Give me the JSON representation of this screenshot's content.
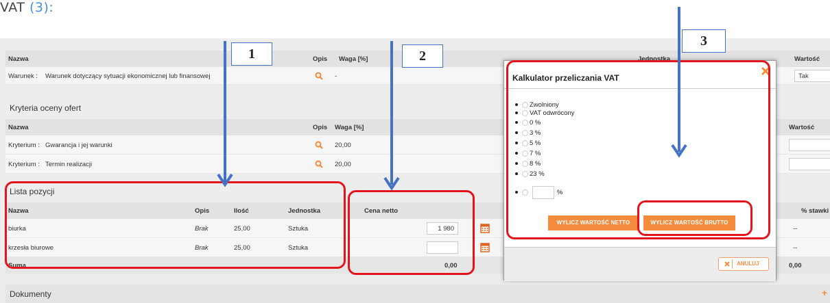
{
  "intro": {
    "text": "VAT",
    "number": "(3):"
  },
  "conditions": {
    "headers": {
      "name": "Nazwa",
      "desc": "Opis",
      "weight": "Waga [%]",
      "unit": "Jednostka",
      "value": "Wartość"
    },
    "row": {
      "label": "Warunek :",
      "text": "Warunek dotyczący sytuacji ekonomicznej lub finansowej",
      "weight": "-",
      "value": "Tak"
    }
  },
  "criteria": {
    "title": "Kryteria oceny ofert",
    "headers": {
      "name": "Nazwa",
      "desc": "Opis",
      "weight": "Waga [%]",
      "value": "Wartość"
    },
    "rows": [
      {
        "label": "Kryterium :",
        "text": "Gwarancja i jej warunki",
        "weight": "20,00"
      },
      {
        "label": "Kryterium :",
        "text": "Termin realizacji",
        "weight": "20,00"
      }
    ]
  },
  "positions": {
    "title": "Lista pozycji",
    "headers": {
      "name": "Nazwa",
      "desc": "Opis",
      "qty": "Ilość",
      "unit": "Jednostka",
      "price": "Cena netto",
      "vat_rate": "% stawki"
    },
    "rows": [
      {
        "name": "biurka",
        "desc": "Brak",
        "qty": "25,00",
        "unit": "Sztuka",
        "price": "1 980",
        "vat": "--"
      },
      {
        "name": "krzesła biurowe",
        "desc": "Brak",
        "qty": "25,00",
        "unit": "Sztuka",
        "price": "",
        "vat": "--"
      }
    ],
    "sum_label": "Suma",
    "sum_price": "0,00",
    "sum_right": "0,00"
  },
  "documents": {
    "title": "Dokumenty",
    "add": "+"
  },
  "modal": {
    "title": "Kalkulator przeliczania VAT",
    "options": [
      "Zwolniony",
      "VAT odwrócony",
      "0 %",
      "3 %",
      "5 %",
      "7 %",
      "8 %",
      "23 %"
    ],
    "custom_suffix": "%",
    "btn_net": "WYLICZ WARTOŚĆ NETTO",
    "btn_gross": "WYLICZ WARTOŚĆ BRUTTO",
    "cancel": "ANULUJ"
  },
  "annotations": [
    "1",
    "2",
    "3"
  ],
  "colors": {
    "accent": "#f58b3d",
    "highlight": "#e3141b",
    "arrow": "#4472c4"
  }
}
